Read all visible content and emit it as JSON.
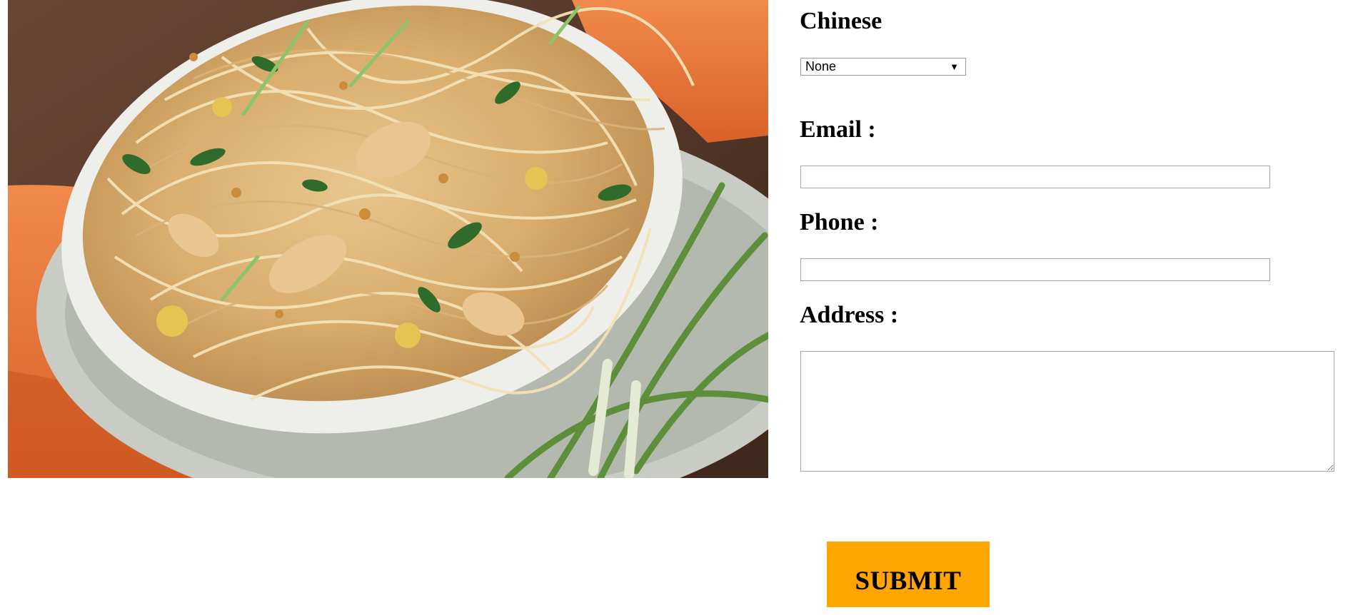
{
  "category": {
    "heading": "Chinese",
    "select_value": "None",
    "arrow_icon": "triangle-down-icon"
  },
  "email": {
    "label": "Email :",
    "value": ""
  },
  "phone": {
    "label": "Phone :",
    "value": ""
  },
  "address": {
    "label": "Address :",
    "value": ""
  },
  "submit": {
    "label": "SUBMIT",
    "color": "#ffa500"
  },
  "photo": {
    "subject": "noodle-dish-photo"
  }
}
